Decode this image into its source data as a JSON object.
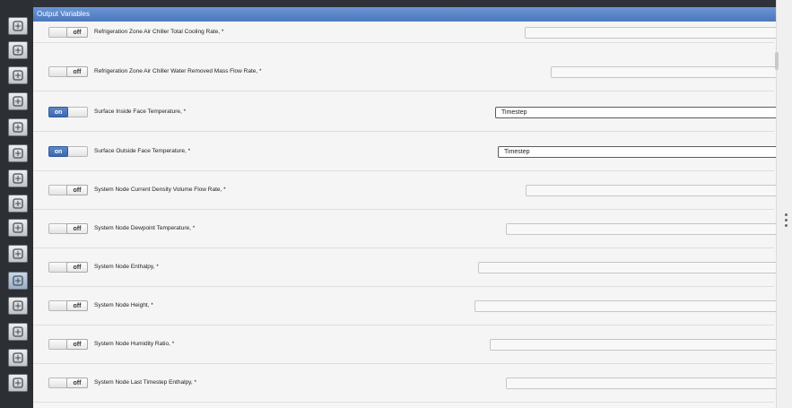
{
  "panel": {
    "title": "Output Variables"
  },
  "toggle_labels": {
    "on": "on",
    "off": "off"
  },
  "sidebar": {
    "items": [
      {
        "icon": "circle-icon"
      },
      {
        "icon": "document-icon"
      },
      {
        "icon": "construction-icon"
      },
      {
        "icon": "schedule-icon"
      },
      {
        "icon": "loads-icon"
      },
      {
        "icon": "space-types-icon"
      },
      {
        "icon": "building-icon"
      },
      {
        "icon": "zone-icon"
      },
      {
        "icon": "hvac-icon"
      },
      {
        "icon": "loop-icon"
      },
      {
        "icon": "variables-icon",
        "active": true
      },
      {
        "icon": "settings-icon"
      },
      {
        "icon": "results-icon"
      },
      {
        "icon": "run-icon"
      },
      {
        "icon": "report-icon"
      }
    ]
  },
  "rows": [
    {
      "state": "off",
      "label": "Refrigeration Zone Air Chiller Total Cooling Rate,  *",
      "frequency": ""
    },
    {
      "state": "off",
      "label": "Refrigeration Zone Air Chiller Water Removed Mass Flow Rate,  *",
      "frequency": ""
    },
    {
      "state": "on",
      "label": "Surface Inside Face Temperature,  *",
      "frequency": "Timestep"
    },
    {
      "state": "on",
      "label": "Surface Outside Face Temperature,  *",
      "frequency": "Timestep"
    },
    {
      "state": "off",
      "label": "System Node Current Density Volume Flow Rate,  *",
      "frequency": ""
    },
    {
      "state": "off",
      "label": "System Node Dewpoint Temperature,  *",
      "frequency": ""
    },
    {
      "state": "off",
      "label": "System Node Enthalpy,  *",
      "frequency": ""
    },
    {
      "state": "off",
      "label": "System Node Height,  *",
      "frequency": ""
    },
    {
      "state": "off",
      "label": "System Node Humidity Ratio,  *",
      "frequency": ""
    },
    {
      "state": "off",
      "label": "System Node Last Timestep Enthalpy,  *",
      "frequency": ""
    }
  ]
}
